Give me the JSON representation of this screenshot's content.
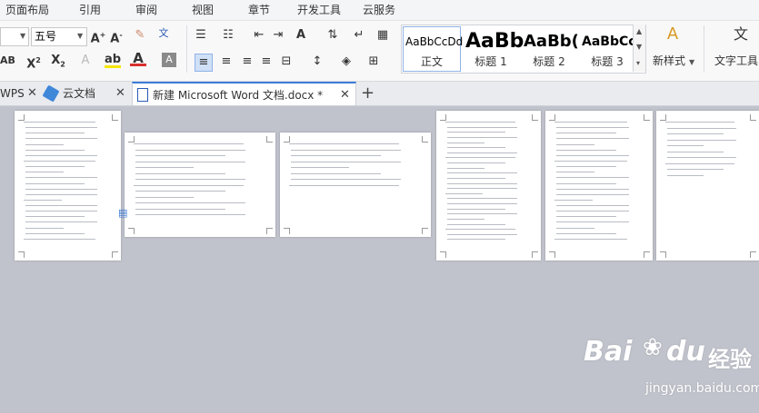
{
  "menu": [
    "页面布局",
    "引用",
    "审阅",
    "视图",
    "章节",
    "开发工具",
    "云服务"
  ],
  "font_size": "五号",
  "styles": [
    {
      "sample": "AaBbCcDd",
      "label": "正文"
    },
    {
      "sample": "AaBb",
      "label": "标题 1"
    },
    {
      "sample": "AaBb(",
      "label": "标题 2"
    },
    {
      "sample": "AaBbCcI",
      "label": "标题 3"
    }
  ],
  "new_style_label": "新样式",
  "text_tool_label": "文字工具",
  "tabs": [
    {
      "label": "WPS"
    },
    {
      "label": "云文档"
    },
    {
      "label": "新建 Microsoft Word 文档.docx *"
    }
  ],
  "watermark": {
    "brand": "Bai",
    "brand2": "du",
    "product": "经验",
    "url": "jingyan.baidu.com"
  },
  "colors": {
    "accent": "#3d7bd8",
    "workspace": "#c1c3cc",
    "font_color": "#d9302c",
    "highlight": "#f5e600"
  }
}
